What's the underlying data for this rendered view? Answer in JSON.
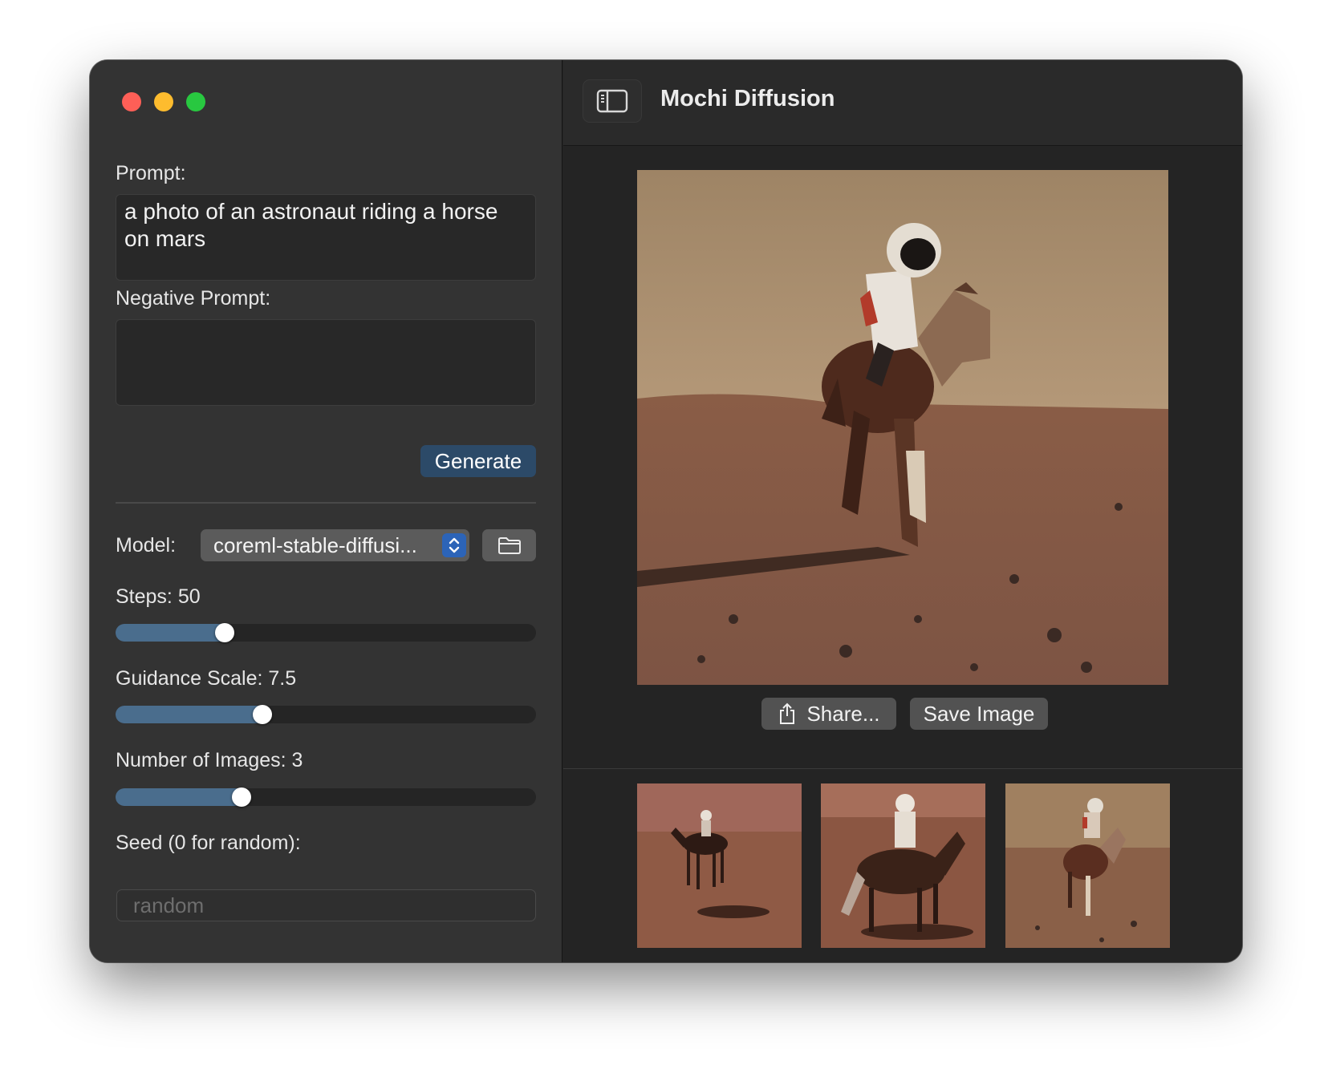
{
  "window": {
    "title": "Mochi Diffusion"
  },
  "sidebar": {
    "prompt_label": "Prompt:",
    "prompt_value": "a photo of an astronaut riding a horse on mars",
    "negative_prompt_label": "Negative Prompt:",
    "negative_prompt_value": "",
    "generate_label": "Generate",
    "model_label": "Model:",
    "model_value": "coreml-stable-diffusi...",
    "steps_label": "Steps: 50",
    "steps_level": 0.26,
    "guidance_label": "Guidance Scale: 7.5",
    "guidance_level": 0.35,
    "images_label": "Number of Images: 3",
    "images_level": 0.3,
    "seed_label": "Seed (0 for random):",
    "seed_placeholder": "random"
  },
  "main": {
    "share_label": "Share...",
    "save_label": "Save Image"
  },
  "colors": {
    "accent": "#2c4a68",
    "slider_fill": "#4a6d8d",
    "close": "#fe5f57",
    "minimize": "#febc2e",
    "zoom": "#28c840"
  },
  "icons": [
    "sidebar-toggle-icon",
    "folder-icon",
    "share-icon",
    "select-arrows-icon"
  ]
}
